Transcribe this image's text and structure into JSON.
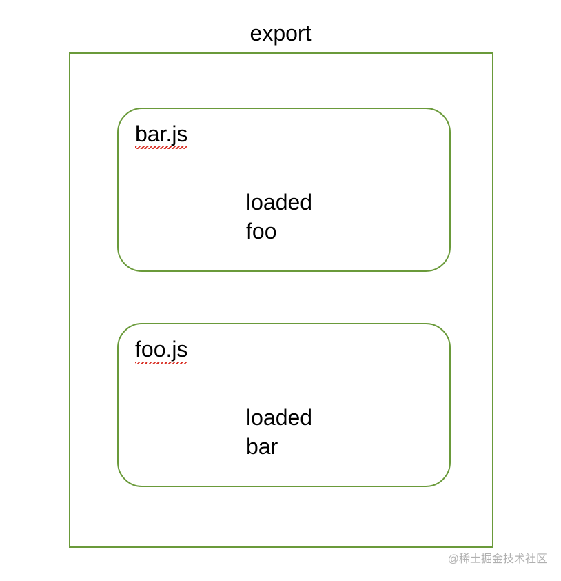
{
  "title": "export",
  "modules": [
    {
      "name": "bar.js",
      "content_line1": "loaded",
      "content_line2": "foo"
    },
    {
      "name": "foo.js",
      "content_line1": "loaded",
      "content_line2": "bar"
    }
  ],
  "watermark": "@稀土掘金技术社区",
  "colors": {
    "border": "#6a9a3a",
    "text": "#000000",
    "watermark": "#b0b0b0"
  }
}
